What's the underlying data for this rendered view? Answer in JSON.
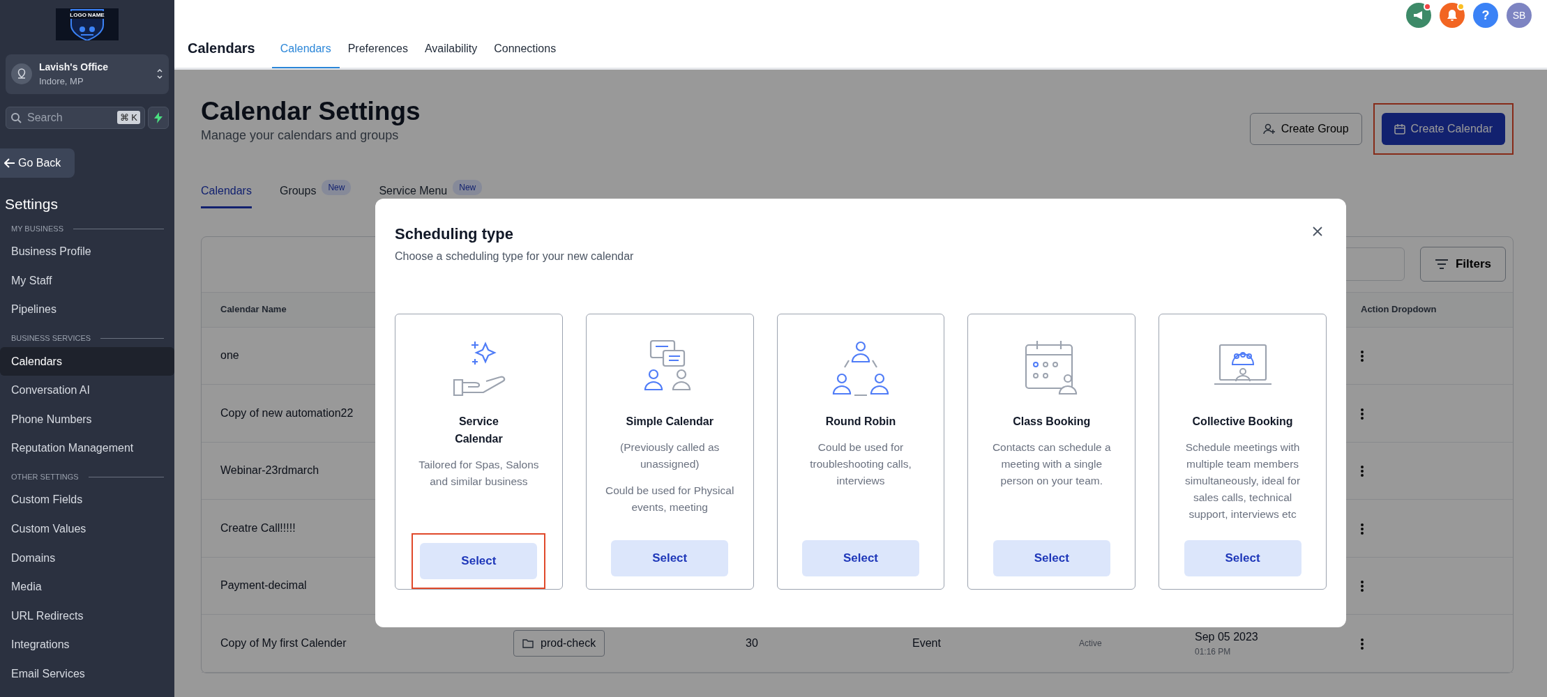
{
  "sidebar": {
    "logo_text": "LOGO NAME",
    "location": {
      "name": "Lavish's Office",
      "address": "Indore, MP"
    },
    "search": {
      "placeholder": "Search",
      "shortcut": "⌘ K"
    },
    "back_button": "Go Back",
    "heading": "Settings",
    "sections": [
      {
        "title": "MY BUSINESS",
        "items": [
          {
            "label": "Business Profile",
            "selected": false
          },
          {
            "label": "My Staff",
            "selected": false
          },
          {
            "label": "Pipelines",
            "selected": false
          }
        ]
      },
      {
        "title": "BUSINESS SERVICES",
        "items": [
          {
            "label": "Calendars",
            "selected": true
          },
          {
            "label": "Conversation AI",
            "selected": false
          },
          {
            "label": "Phone Numbers",
            "selected": false
          },
          {
            "label": "Reputation Management",
            "selected": false
          }
        ]
      },
      {
        "title": "OTHER SETTINGS",
        "items": [
          {
            "label": "Custom Fields",
            "selected": false
          },
          {
            "label": "Custom Values",
            "selected": false
          },
          {
            "label": "Domains",
            "selected": false
          },
          {
            "label": "Media",
            "selected": false
          },
          {
            "label": "URL Redirects",
            "selected": false
          },
          {
            "label": "Integrations",
            "selected": false
          },
          {
            "label": "Email Services",
            "selected": false
          }
        ]
      }
    ]
  },
  "header": {
    "title": "Calendars",
    "tabs": [
      {
        "label": "Calendars",
        "selected": true
      },
      {
        "label": "Preferences",
        "selected": false
      },
      {
        "label": "Availability",
        "selected": false
      },
      {
        "label": "Connections",
        "selected": false
      }
    ],
    "help": "?",
    "avatar": "SB"
  },
  "page": {
    "title": "Calendar Settings",
    "subtitle": "Manage your calendars and groups",
    "buttons": [
      {
        "label": "Create Group",
        "kind": "outline",
        "highlighted": false
      },
      {
        "label": "Create Calendar",
        "kind": "primary",
        "highlighted": true
      }
    ],
    "tabs": [
      {
        "label": "Calendars",
        "selected": true
      },
      {
        "label": "Groups",
        "badge": "New",
        "selected": false
      },
      {
        "label": "Service Menu",
        "badge": "New",
        "selected": false
      }
    ]
  },
  "table": {
    "filters_button": "Filters",
    "name_column": "Calendar Name",
    "action_column": "Action Dropdown",
    "rows": [
      {
        "name": "one"
      },
      {
        "name": "Copy of new automation22"
      },
      {
        "name": "Webinar-23rdmarch"
      },
      {
        "name": "Creatre Call!!!!!"
      },
      {
        "name": "Payment-decimal"
      },
      {
        "name": "Copy of My first Calender",
        "group": "prod-check",
        "count": "30",
        "type": "Event",
        "status": "Active",
        "date": "Sep 05 2023",
        "time": "01:16 PM"
      }
    ]
  },
  "modal": {
    "title": "Scheduling type",
    "subtitle": "Choose a scheduling type for your new calendar",
    "cards": [
      {
        "kind": "service",
        "title": "Service Calendar",
        "descriptions": [
          "Tailored for Spas, Salons and similar business"
        ],
        "button": "Select",
        "highlighted": true
      },
      {
        "kind": "simple",
        "title": "Simple Calendar",
        "descriptions": [
          "(Previously called as unassigned)",
          "Could be used for Physical events, meeting"
        ],
        "button": "Select",
        "highlighted": false
      },
      {
        "kind": "round_robin",
        "title": "Round Robin",
        "descriptions": [
          "Could be used for troubleshooting calls, interviews"
        ],
        "button": "Select",
        "highlighted": false
      },
      {
        "kind": "class",
        "title": "Class Booking",
        "descriptions": [
          "Contacts can schedule a meeting with a single person on your team."
        ],
        "button": "Select",
        "highlighted": false
      },
      {
        "kind": "collective",
        "title": "Collective Booking",
        "descriptions": [
          "Schedule meetings with multiple team members simultaneously, ideal for sales calls, technical support, interviews etc"
        ],
        "button": "Select",
        "highlighted": false
      }
    ]
  }
}
